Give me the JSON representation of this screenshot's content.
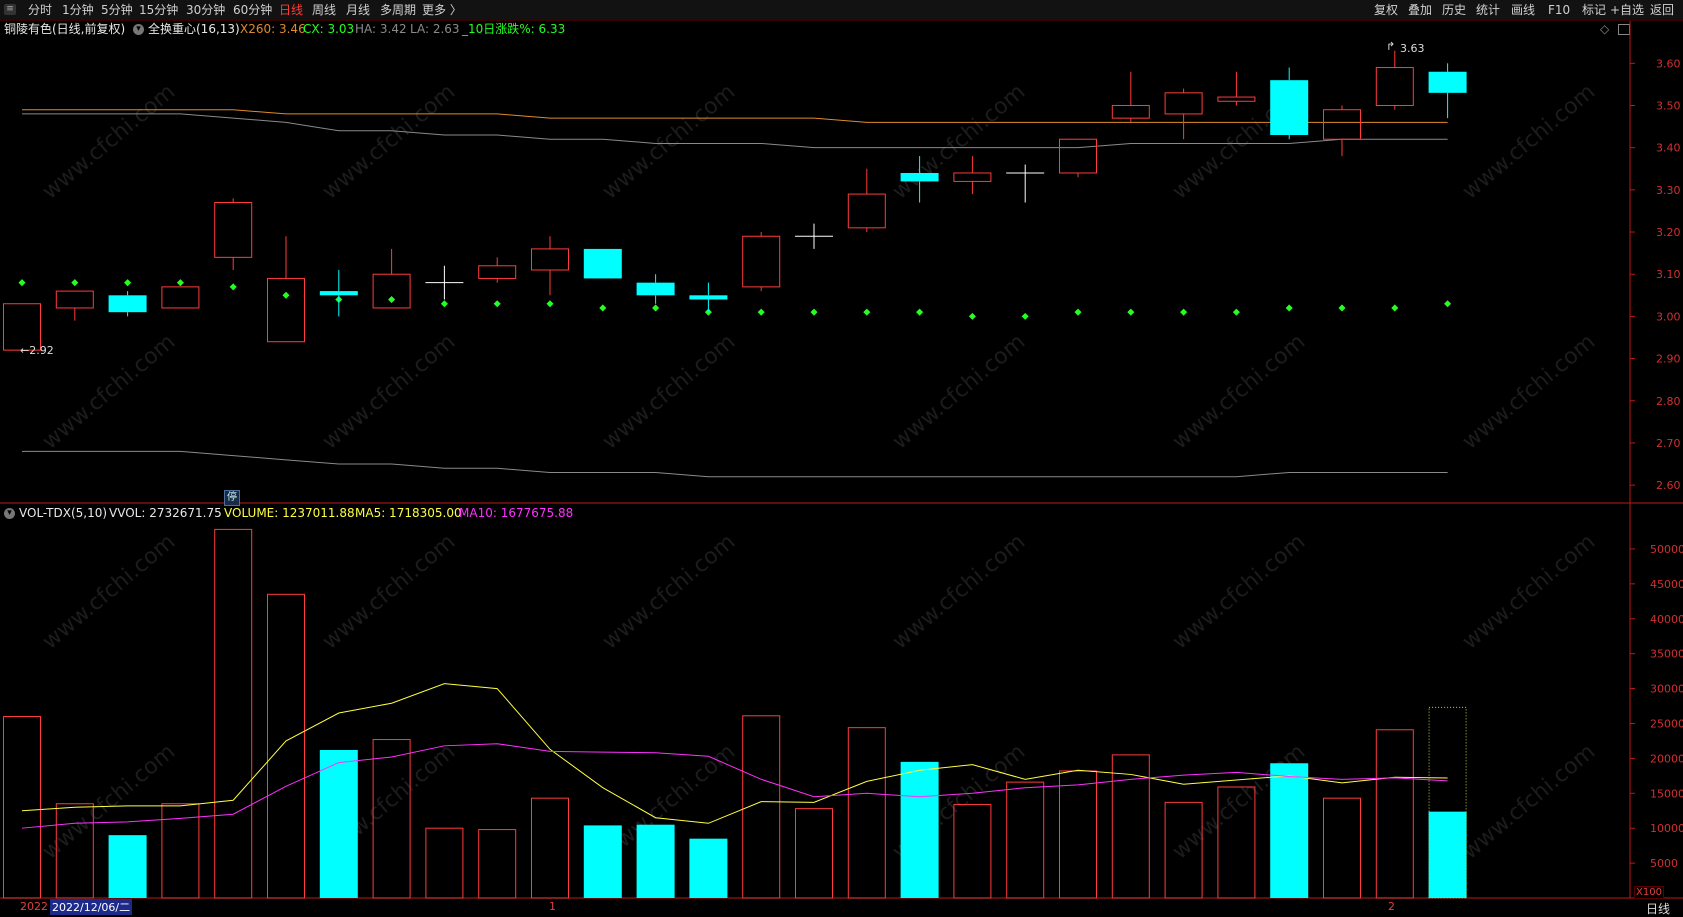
{
  "toolbar": {
    "periods": [
      "分时",
      "1分钟",
      "5分钟",
      "15分钟",
      "30分钟",
      "60分钟",
      "日线",
      "周线",
      "月线",
      "多周期",
      "更多 〉"
    ],
    "active_period": "日线",
    "right_tools": [
      "复权",
      "叠加",
      "历史",
      "统计",
      "画线",
      "F10",
      "标记",
      "+自选",
      "返回"
    ]
  },
  "price_header": {
    "stock": "铜陵有色(日线,前复权)",
    "indicator": "全换重心(16,13)",
    "x260": "X260: 3.46",
    "cx": "CX: 3.03",
    "ha": "HA: 3.42",
    "la": "LA: 2.63",
    "change10": "_10日涨跌%: 6.33"
  },
  "volume_header": {
    "indicator": "VOL-TDX(5,10)",
    "vvol": "VVOL: 2732671.75",
    "volume": "VOLUME: 1237011.88",
    "ma5": "MA5: 1718305.00",
    "ma10": "MA10: 1677675.88"
  },
  "annotations": {
    "low_mark": "←2.92",
    "high_mark": "3.63",
    "badge": "停"
  },
  "x_axis": {
    "year": "2022",
    "date": "2022/12/06/二",
    "tick_1": "1",
    "tick_2": "2",
    "unit": "X100",
    "period": "日线"
  },
  "watermark": "www.cfchi.com",
  "colors": {
    "up": "#ff3b3b",
    "down": "#00ffff",
    "x260_line": "#e08a2a",
    "gray_line": "#8a8a8a",
    "dot": "#22ff22",
    "ma5": "#ffff40",
    "ma10": "#ff30ff",
    "axis": "#c01818"
  },
  "chart_data": [
    {
      "type": "candlestick",
      "name": "price",
      "ylim": [
        2.56,
        3.66
      ],
      "y_ticks": [
        2.6,
        2.7,
        2.8,
        2.9,
        3.0,
        3.1,
        3.2,
        3.3,
        3.4,
        3.5,
        3.6
      ],
      "candles": [
        {
          "o": 2.92,
          "h": 3.03,
          "l": 2.92,
          "c": 3.03
        },
        {
          "o": 3.02,
          "h": 3.06,
          "l": 2.99,
          "c": 3.06
        },
        {
          "o": 3.05,
          "h": 3.06,
          "l": 3.0,
          "c": 3.01
        },
        {
          "o": 3.02,
          "h": 3.07,
          "l": 3.02,
          "c": 3.07
        },
        {
          "o": 3.14,
          "h": 3.28,
          "l": 3.11,
          "c": 3.27
        },
        {
          "o": 2.94,
          "h": 3.19,
          "l": 2.94,
          "c": 3.09
        },
        {
          "o": 3.06,
          "h": 3.11,
          "l": 3.0,
          "c": 3.05
        },
        {
          "o": 3.02,
          "h": 3.16,
          "l": 3.02,
          "c": 3.1
        },
        {
          "o": 3.08,
          "h": 3.12,
          "l": 3.04,
          "c": 3.08
        },
        {
          "o": 3.09,
          "h": 3.14,
          "l": 3.08,
          "c": 3.12
        },
        {
          "o": 3.11,
          "h": 3.19,
          "l": 3.05,
          "c": 3.16
        },
        {
          "o": 3.16,
          "h": 3.16,
          "l": 3.09,
          "c": 3.09
        },
        {
          "o": 3.08,
          "h": 3.1,
          "l": 3.03,
          "c": 3.05
        },
        {
          "o": 3.05,
          "h": 3.08,
          "l": 3.01,
          "c": 3.04
        },
        {
          "o": 3.07,
          "h": 3.2,
          "l": 3.06,
          "c": 3.19
        },
        {
          "o": 3.19,
          "h": 3.22,
          "l": 3.16,
          "c": 3.19
        },
        {
          "o": 3.21,
          "h": 3.35,
          "l": 3.2,
          "c": 3.29
        },
        {
          "o": 3.34,
          "h": 3.38,
          "l": 3.27,
          "c": 3.32
        },
        {
          "o": 3.32,
          "h": 3.38,
          "l": 3.29,
          "c": 3.34
        },
        {
          "o": 3.34,
          "h": 3.36,
          "l": 3.27,
          "c": 3.34
        },
        {
          "o": 3.34,
          "h": 3.42,
          "l": 3.33,
          "c": 3.42
        },
        {
          "o": 3.47,
          "h": 3.58,
          "l": 3.46,
          "c": 3.5
        },
        {
          "o": 3.48,
          "h": 3.54,
          "l": 3.42,
          "c": 3.53
        },
        {
          "o": 3.51,
          "h": 3.58,
          "l": 3.5,
          "c": 3.52
        },
        {
          "o": 3.56,
          "h": 3.59,
          "l": 3.42,
          "c": 3.43
        },
        {
          "o": 3.42,
          "h": 3.5,
          "l": 3.38,
          "c": 3.49
        },
        {
          "o": 3.5,
          "h": 3.63,
          "l": 3.49,
          "c": 3.59
        },
        {
          "o": 3.58,
          "h": 3.6,
          "l": 3.47,
          "c": 3.53
        }
      ],
      "x260": [
        3.49,
        3.49,
        3.49,
        3.49,
        3.49,
        3.48,
        3.48,
        3.48,
        3.48,
        3.48,
        3.47,
        3.47,
        3.47,
        3.47,
        3.47,
        3.47,
        3.46,
        3.46,
        3.46,
        3.46,
        3.46,
        3.46,
        3.46,
        3.46,
        3.46,
        3.46,
        3.46,
        3.46
      ],
      "ha": [
        3.48,
        3.48,
        3.48,
        3.48,
        3.47,
        3.46,
        3.44,
        3.44,
        3.43,
        3.43,
        3.42,
        3.42,
        3.41,
        3.41,
        3.41,
        3.4,
        3.4,
        3.4,
        3.4,
        3.4,
        3.4,
        3.41,
        3.41,
        3.41,
        3.41,
        3.42,
        3.42,
        3.42
      ],
      "la": [
        2.68,
        2.68,
        2.68,
        2.68,
        2.67,
        2.66,
        2.65,
        2.65,
        2.64,
        2.64,
        2.63,
        2.63,
        2.63,
        2.62,
        2.62,
        2.62,
        2.62,
        2.62,
        2.62,
        2.62,
        2.62,
        2.62,
        2.62,
        2.62,
        2.63,
        2.63,
        2.63,
        2.63
      ],
      "cx": [
        3.08,
        3.08,
        3.08,
        3.08,
        3.07,
        3.05,
        3.04,
        3.04,
        3.03,
        3.03,
        3.03,
        3.02,
        3.02,
        3.01,
        3.01,
        3.01,
        3.01,
        3.01,
        3.0,
        3.0,
        3.01,
        3.01,
        3.01,
        3.01,
        3.02,
        3.02,
        3.02,
        3.03
      ]
    },
    {
      "type": "bar",
      "name": "volume",
      "ylim": [
        0,
        53000
      ],
      "y_ticks": [
        5000,
        10000,
        15000,
        20000,
        25000,
        30000,
        35000,
        40000,
        45000,
        50000
      ],
      "values": [
        26000,
        13500,
        9000,
        13500,
        52800,
        43500,
        21200,
        22700,
        10000,
        9800,
        14300,
        10400,
        10500,
        8500,
        26100,
        12800,
        24400,
        19500,
        13400,
        16600,
        18200,
        20500,
        13700,
        15900,
        19300,
        14300,
        24100,
        12370
      ],
      "tomorrow_placeholder": 27300,
      "ma5": [
        12500,
        13000,
        13200,
        13200,
        14000,
        22500,
        26500,
        27900,
        30700,
        30000,
        21300,
        15800,
        11500,
        10700,
        13800,
        13700,
        16700,
        18300,
        19100,
        17000,
        18300,
        17700,
        16300,
        16900,
        17500,
        16500,
        17300,
        17183
      ],
      "ma10": [
        10000,
        10700,
        10900,
        11400,
        12000,
        16000,
        19400,
        20200,
        21800,
        22100,
        21000,
        20900,
        20800,
        20300,
        17000,
        14500,
        15000,
        14500,
        15000,
        15800,
        16200,
        17000,
        17600,
        18000,
        17400,
        17000,
        17200,
        16777
      ]
    }
  ]
}
